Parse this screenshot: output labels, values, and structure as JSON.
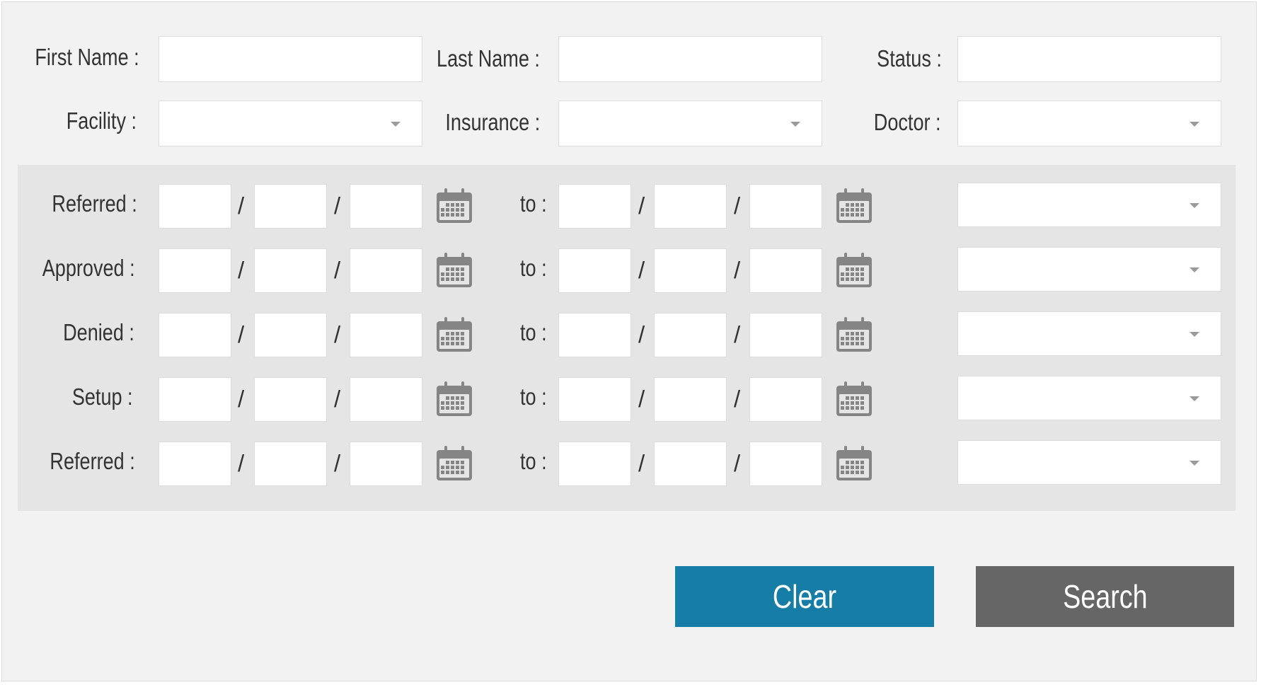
{
  "filters": {
    "first_name_label": "First Name :",
    "last_name_label": "Last Name :",
    "status_label": "Status :",
    "facility_label": "Facility :",
    "insurance_label": "Insurance :",
    "doctor_label": "Doctor :"
  },
  "date_rows": [
    {
      "label": "Referred :",
      "to_label": "to :"
    },
    {
      "label": "Approved :",
      "to_label": "to :"
    },
    {
      "label": "Denied :",
      "to_label": "to :"
    },
    {
      "label": "Setup :",
      "to_label": "to :"
    },
    {
      "label": "Referred :",
      "to_label": "to :"
    }
  ],
  "date_separator": "/",
  "icons": {
    "calendar": "calendar-icon",
    "dropdown": "chevron-down-icon"
  },
  "actions": {
    "clear_label": "Clear",
    "search_label": "Search"
  },
  "colors": {
    "clear_button": "#167ea6",
    "search_button": "#666666",
    "panel": "#f2f2f2",
    "date_band": "#e5e5e5"
  }
}
